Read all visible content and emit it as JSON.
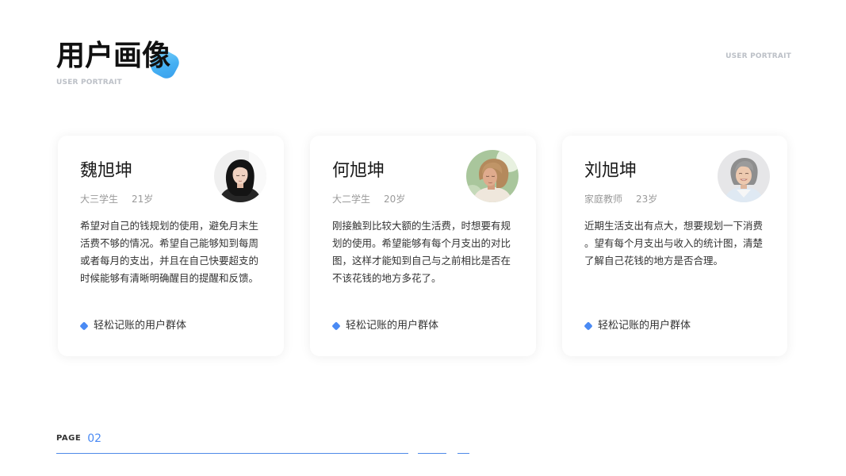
{
  "header": {
    "title": "用户画像",
    "subtitle": "USER PORTRAIT",
    "corner_label": "USER PORTRAIT"
  },
  "cards": [
    {
      "name": "魏旭坤",
      "role": "大三学生",
      "age": "21岁",
      "description_lines": [
        "希望对自己的钱规划的使用，避免月末生",
        "活费不够的情况。希望自己能够知到每周",
        "或者每月的支出，并且在自己快要超支的",
        "时候能够有清晰明确醒目的提醒和反馈。"
      ],
      "tag": "轻松记账的用户群体"
    },
    {
      "name": "何旭坤",
      "role": "大二学生",
      "age": "20岁",
      "description_lines": [
        "刚接触到比较大额的生活费，时想要有规",
        "划的使用。希望能够有每个月支出的对比",
        "图，这样才能知到自己与之前相比是否在",
        "不该花钱的地方多花了。"
      ],
      "tag": "轻松记账的用户群体"
    },
    {
      "name": "刘旭坤",
      "role": "家庭教师",
      "age": "23岁",
      "description_lines": [
        "近期生活支出有点大，想要规划一下消费",
        "。望有每个月支出与收入的统计图，清楚",
        "了解自己花钱的地方是否合理。"
      ],
      "tag": "轻松记账的用户群体"
    }
  ],
  "footer": {
    "page_label": "PAGE",
    "page_number": "02"
  },
  "colors": {
    "accent": "#4a8af4",
    "title_blob": "#45b0f3",
    "footer_line": "#4f8ae8"
  }
}
